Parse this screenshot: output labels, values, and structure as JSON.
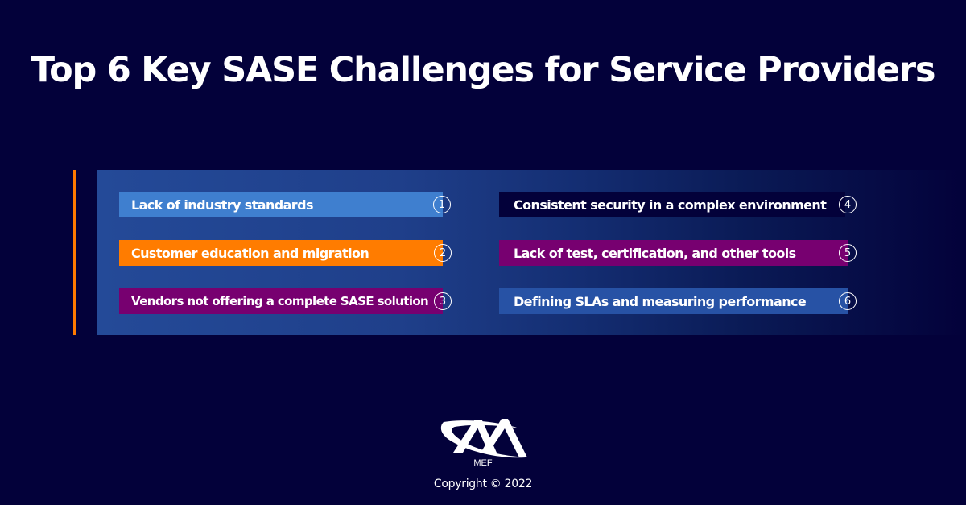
{
  "title": "Top 6 Key SASE Challenges for Service Providers",
  "colors": {
    "background": "#03013a",
    "accent_line": "#ff7a00",
    "light_blue": "#3f7fcf",
    "orange": "#ff7c00",
    "purple": "#770070",
    "dark_navy": "#03013a",
    "mid_blue": "#2752a5"
  },
  "challenges": [
    {
      "number": "1",
      "label": "Lack of industry standards",
      "color": "#3f7fcf"
    },
    {
      "number": "2",
      "label": "Customer education and migration",
      "color": "#ff7c00"
    },
    {
      "number": "3",
      "label": "Vendors not offering a complete SASE solution",
      "color": "#770070"
    },
    {
      "number": "4",
      "label": "Consistent security in a complex environment",
      "color": "#03013a"
    },
    {
      "number": "5",
      "label": "Lack of test, certification, and other tools",
      "color": "#770070"
    },
    {
      "number": "6",
      "label": "Defining SLAs and measuring performance",
      "color": "#2752a5"
    }
  ],
  "footer": {
    "logo_icon": "mef-logo-icon",
    "logo_text": "MEF",
    "copyright": "Copyright © 2022"
  }
}
